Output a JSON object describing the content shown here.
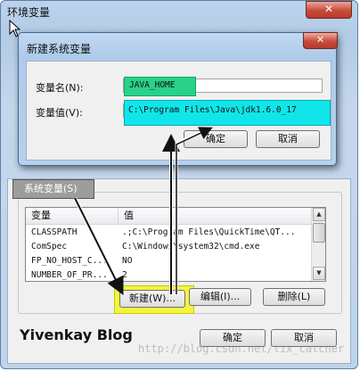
{
  "outer_dialog": {
    "title": "环境变量",
    "close_glyph": "✕",
    "system_vars_label": "系统变量(S)",
    "table": {
      "columns": [
        "变量",
        "值"
      ],
      "rows": [
        {
          "name": "CLASSPATH",
          "value": ".;C:\\Program Files\\QuickTime\\QT..."
        },
        {
          "name": "ComSpec",
          "value": "C:\\Windows\\system32\\cmd.exe"
        },
        {
          "name": "FP_NO_HOST_C...",
          "value": "NO"
        },
        {
          "name": "NUMBER_OF_PR...",
          "value": "2"
        }
      ]
    },
    "buttons": {
      "new": "新建(W)...",
      "edit": "编辑(I)...",
      "delete": "删除(L)"
    },
    "ok": "确定",
    "cancel": "取消"
  },
  "inner_dialog": {
    "title": "新建系统变量",
    "close_glyph": "✕",
    "name_label": "变量名(N):",
    "value_label": "变量值(V):",
    "name_value": "JAVA_HOME",
    "value_value": "C:\\Program Files\\Java\\jdk1.6.0_17",
    "ok": "确定",
    "cancel": "取消"
  },
  "brand": "Yivenkay Blog",
  "watermark": "http://blog.csdn.net/lix_catcher",
  "icons": [
    "close-icon",
    "scroll-up-icon",
    "scroll-down-icon",
    "arrow-annotation-icon",
    "mouse-cursor-icon"
  ],
  "colors": {
    "name_highlight": "#29d18a",
    "value_highlight": "#10e6e9",
    "button_highlight": "#f4f442",
    "close_red": "#c94a39",
    "title_blue": "#b7d0ec"
  }
}
